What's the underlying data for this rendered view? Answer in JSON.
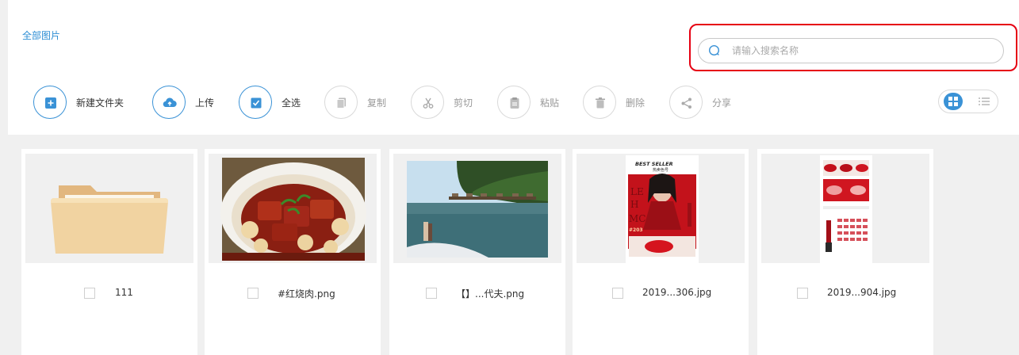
{
  "breadcrumb": "全部图片",
  "search": {
    "placeholder": "请输入搜索名称"
  },
  "toolbar": [
    {
      "label": "新建文件夹",
      "icon": "new-folder-icon",
      "active": true
    },
    {
      "label": "上传",
      "icon": "upload-icon",
      "active": true
    },
    {
      "label": "全选",
      "icon": "select-all-icon",
      "active": true
    },
    {
      "label": "复制",
      "icon": "copy-icon",
      "active": false
    },
    {
      "label": "剪切",
      "icon": "scissors-icon",
      "active": false
    },
    {
      "label": "粘贴",
      "icon": "paste-icon",
      "active": false
    },
    {
      "label": "删除",
      "icon": "trash-icon",
      "active": false
    },
    {
      "label": "分享",
      "icon": "share-icon",
      "active": false
    }
  ],
  "view_toggle": {
    "selected": "grid"
  },
  "files": [
    {
      "name": "111",
      "type": "folder"
    },
    {
      "name": "#红烧肉.png",
      "type": "image",
      "image": "braised-pork-photo"
    },
    {
      "name": "【】...代夫.png",
      "type": "image",
      "image": "beach-water-villa-photo"
    },
    {
      "name": "2019...306.jpg",
      "type": "image",
      "image": "lipstick-ad-poster"
    },
    {
      "name": "2019...904.jpg",
      "type": "image",
      "image": "lipstick-swatch-poster"
    }
  ],
  "poster": {
    "heading": "BEST SELLER",
    "sub": "热卖色号",
    "shade": "#203",
    "lines": [
      "LE",
      "H",
      "MC"
    ]
  },
  "colors": {
    "accent": "#3a92d6",
    "highlight": "#e60012"
  }
}
